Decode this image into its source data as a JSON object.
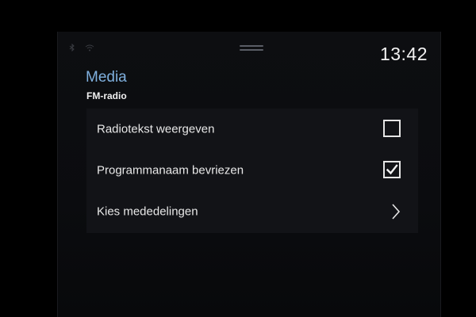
{
  "status_bar": {
    "time": "13:42",
    "icons": [
      "bluetooth-icon",
      "wifi-icon",
      "drag-handle-icon"
    ]
  },
  "header": {
    "title": "Media",
    "subtitle": "FM-radio"
  },
  "settings": [
    {
      "label": "Radiotekst weergeven",
      "control": "checkbox",
      "checked": false
    },
    {
      "label": "Programmanaam bevriezen",
      "control": "checkbox",
      "checked": true
    },
    {
      "label": "Kies mededelingen",
      "control": "chevron-right-icon"
    }
  ],
  "colors": {
    "accent": "#7fb0de",
    "text": "#e8e8e8",
    "panel": "#121317",
    "background": "#000000"
  }
}
